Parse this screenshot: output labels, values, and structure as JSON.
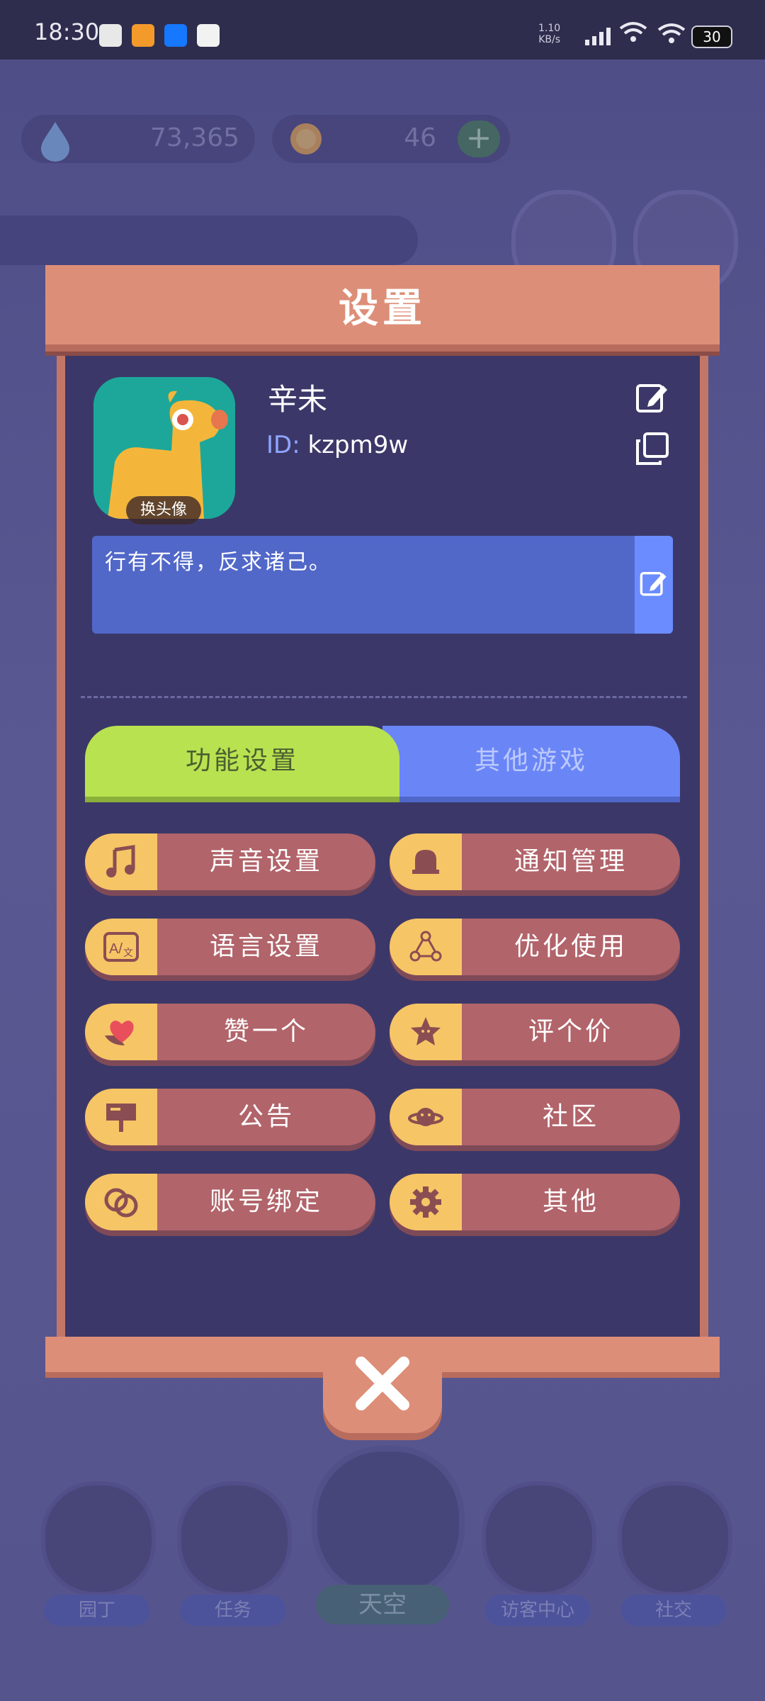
{
  "status_bar": {
    "time": "18:30",
    "net_speed": "1.10",
    "net_unit": "KB/s",
    "battery": "30"
  },
  "resources": {
    "water": "73,365",
    "sun": "46",
    "plus": "+"
  },
  "dialog": {
    "title": "设置",
    "avatar_badge": "换头像",
    "username": "辛未",
    "id_prefix": "ID:",
    "user_id": "kzpm9w",
    "motto": "行有不得，反求诸己。",
    "tabs": {
      "function": "功能设置",
      "other": "其他游戏"
    },
    "items": [
      {
        "label": "声音设置",
        "icon": "music-note-icon"
      },
      {
        "label": "通知管理",
        "icon": "bell-icon"
      },
      {
        "label": "语言设置",
        "icon": "translate-icon"
      },
      {
        "label": "优化使用",
        "icon": "optimize-icon"
      },
      {
        "label": "赞一个",
        "icon": "heart-icon"
      },
      {
        "label": "评个价",
        "icon": "star-icon"
      },
      {
        "label": "公告",
        "icon": "signboard-icon"
      },
      {
        "label": "社区",
        "icon": "planet-icon"
      },
      {
        "label": "账号绑定",
        "icon": "link-icon"
      },
      {
        "label": "其他",
        "icon": "gear-icon"
      }
    ]
  },
  "bottom_nav": {
    "gardener": "园丁",
    "task": "任务",
    "sky": "天空",
    "visitor": "访客中心",
    "social": "社交"
  },
  "colors": {
    "header": "#dd8e78",
    "panel": "#3b3869",
    "tab_active": "#b9e251",
    "tab_inactive": "#6a86f6",
    "item_bg": "#b1646a",
    "item_icon_bg": "#f6c566"
  }
}
